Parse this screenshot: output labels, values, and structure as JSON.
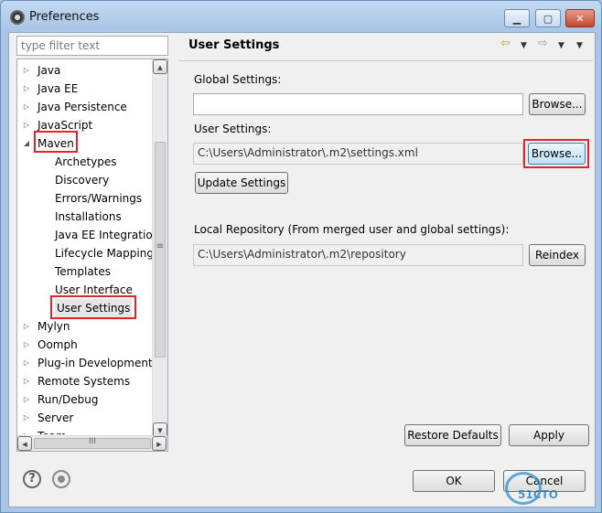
{
  "window": {
    "title": "Preferences"
  },
  "filter": {
    "placeholder": "type filter text"
  },
  "tree": {
    "items": [
      {
        "label": "Java",
        "level": 0,
        "expand": "collapsed"
      },
      {
        "label": "Java EE",
        "level": 0,
        "expand": "collapsed"
      },
      {
        "label": "Java Persistence",
        "level": 0,
        "expand": "collapsed"
      },
      {
        "label": "JavaScript",
        "level": 0,
        "expand": "collapsed"
      },
      {
        "label": "Maven",
        "level": 0,
        "expand": "expanded"
      },
      {
        "label": "Archetypes",
        "level": 1,
        "expand": "none"
      },
      {
        "label": "Discovery",
        "level": 1,
        "expand": "none"
      },
      {
        "label": "Errors/Warnings",
        "level": 1,
        "expand": "none"
      },
      {
        "label": "Installations",
        "level": 1,
        "expand": "none"
      },
      {
        "label": "Java EE Integration",
        "level": 1,
        "expand": "none"
      },
      {
        "label": "Lifecycle Mapping",
        "level": 1,
        "expand": "none"
      },
      {
        "label": "Templates",
        "level": 1,
        "expand": "none"
      },
      {
        "label": "User Interface",
        "level": 1,
        "expand": "none"
      },
      {
        "label": "User Settings",
        "level": 1,
        "expand": "none",
        "selected": true
      },
      {
        "label": "Mylyn",
        "level": 0,
        "expand": "collapsed"
      },
      {
        "label": "Oomph",
        "level": 0,
        "expand": "collapsed"
      },
      {
        "label": "Plug-in Development",
        "level": 0,
        "expand": "collapsed"
      },
      {
        "label": "Remote Systems",
        "level": 0,
        "expand": "collapsed"
      },
      {
        "label": "Run/Debug",
        "level": 0,
        "expand": "collapsed"
      },
      {
        "label": "Server",
        "level": 0,
        "expand": "collapsed"
      },
      {
        "label": "Team",
        "level": 0,
        "expand": "collapsed"
      }
    ],
    "hscroll_grip": "III",
    "vscroll_grip": "≡"
  },
  "panel": {
    "title": "User Settings",
    "global_settings_label": "Global Settings:",
    "global_settings_value": "",
    "global_browse": "Browse...",
    "user_settings_label": "User Settings:",
    "user_settings_value": "C:\\Users\\Administrator\\.m2\\settings.xml",
    "user_browse": "Browse...",
    "update_settings": "Update Settings",
    "local_repo_label": "Local Repository (From merged user and global settings):",
    "local_repo_value": "C:\\Users\\Administrator\\.m2\\repository",
    "reindex": "Reindex",
    "restore_defaults": "Restore Defaults",
    "apply": "Apply"
  },
  "footer": {
    "ok": "OK",
    "cancel": "Cancel",
    "watermark": "51CTO"
  },
  "colors": {
    "highlight": "#e2242b",
    "accent": "#3c7fb1"
  }
}
